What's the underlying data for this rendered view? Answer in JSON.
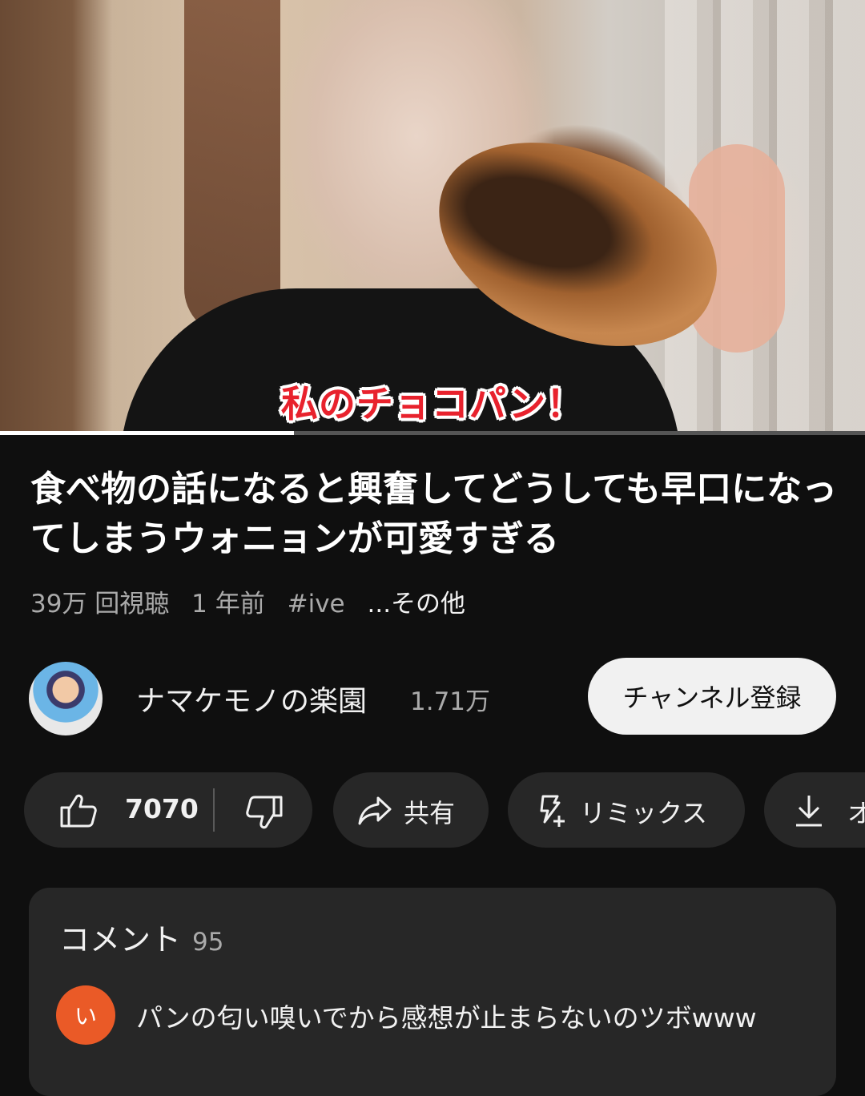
{
  "video": {
    "caption": "私のチョコパン！",
    "progress": 0.34
  },
  "title": "食べ物の話になると興奮してどうしても早口になってしまうウォニョンが可愛すぎる",
  "meta": {
    "views": "39万 回視聴",
    "age": "1 年前",
    "hashtag": "#ive",
    "more": "...その他"
  },
  "channel": {
    "name": "ナマケモノの楽園",
    "subscribers": "1.71万",
    "subscribe_label": "チャンネル登録"
  },
  "actions": {
    "like_count": "7070",
    "share_label": "共有",
    "remix_label": "リミックス",
    "download_label": "オ"
  },
  "comments": {
    "title": "コメント",
    "count": "95",
    "top_comment": {
      "avatar_letter": "い",
      "avatar_color": "#ea5a27",
      "text": "パンの匂い嗅いでから感想が止まらないのツボwww"
    }
  },
  "icons": [
    "like-icon",
    "dislike-icon",
    "share-icon",
    "remix-icon",
    "download-icon"
  ]
}
